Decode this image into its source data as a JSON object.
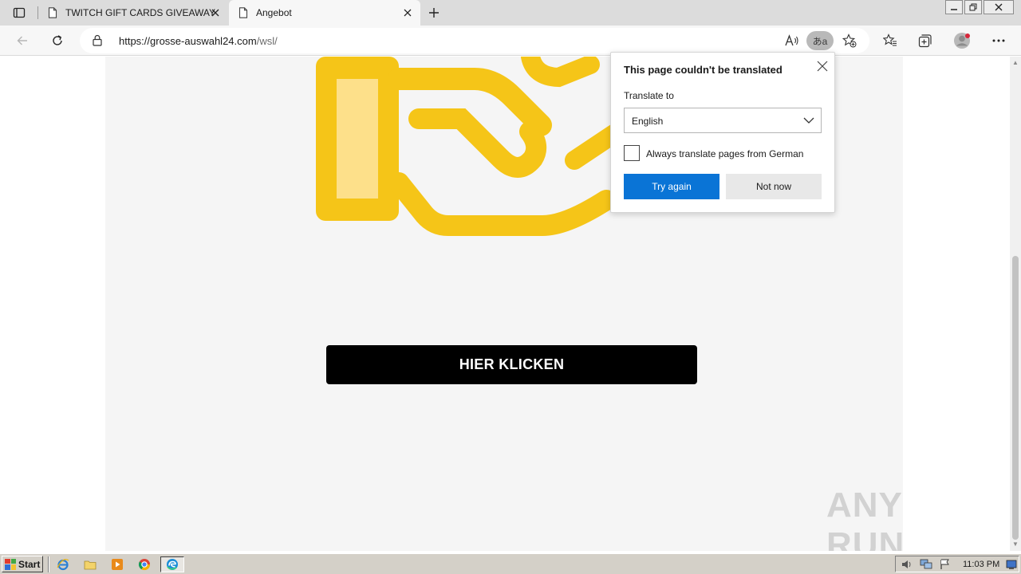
{
  "browser": {
    "tabs": [
      {
        "title": "TWITCH GIFT CARDS GIVEAWAY",
        "active": false
      },
      {
        "title": "Angebot",
        "active": true
      }
    ],
    "address": {
      "host": "https://grosse-auswahl24.com",
      "path": "/wsl/"
    },
    "translate_icon_text": "あa"
  },
  "page": {
    "cta_label": "HIER KLICKEN",
    "watermark": "ANY RUN",
    "colors": {
      "accent": "#f5c518",
      "accent_light": "#fde08a",
      "page_bg": "#f5f5f5",
      "cta_bg": "#000000"
    }
  },
  "translate_popup": {
    "title": "This page couldn't be translated",
    "translate_to_label": "Translate to",
    "selected_language": "English",
    "always_translate_label": "Always translate pages from German",
    "always_translate_checked": false,
    "try_again_label": "Try again",
    "not_now_label": "Not now",
    "colors": {
      "primary": "#0a74d6"
    }
  },
  "taskbar": {
    "start_label": "Start",
    "clock": "11:03 PM",
    "quick_launch": [
      "ie-icon",
      "folder-icon",
      "media-player-icon",
      "chrome-icon",
      "edge-icon"
    ]
  }
}
